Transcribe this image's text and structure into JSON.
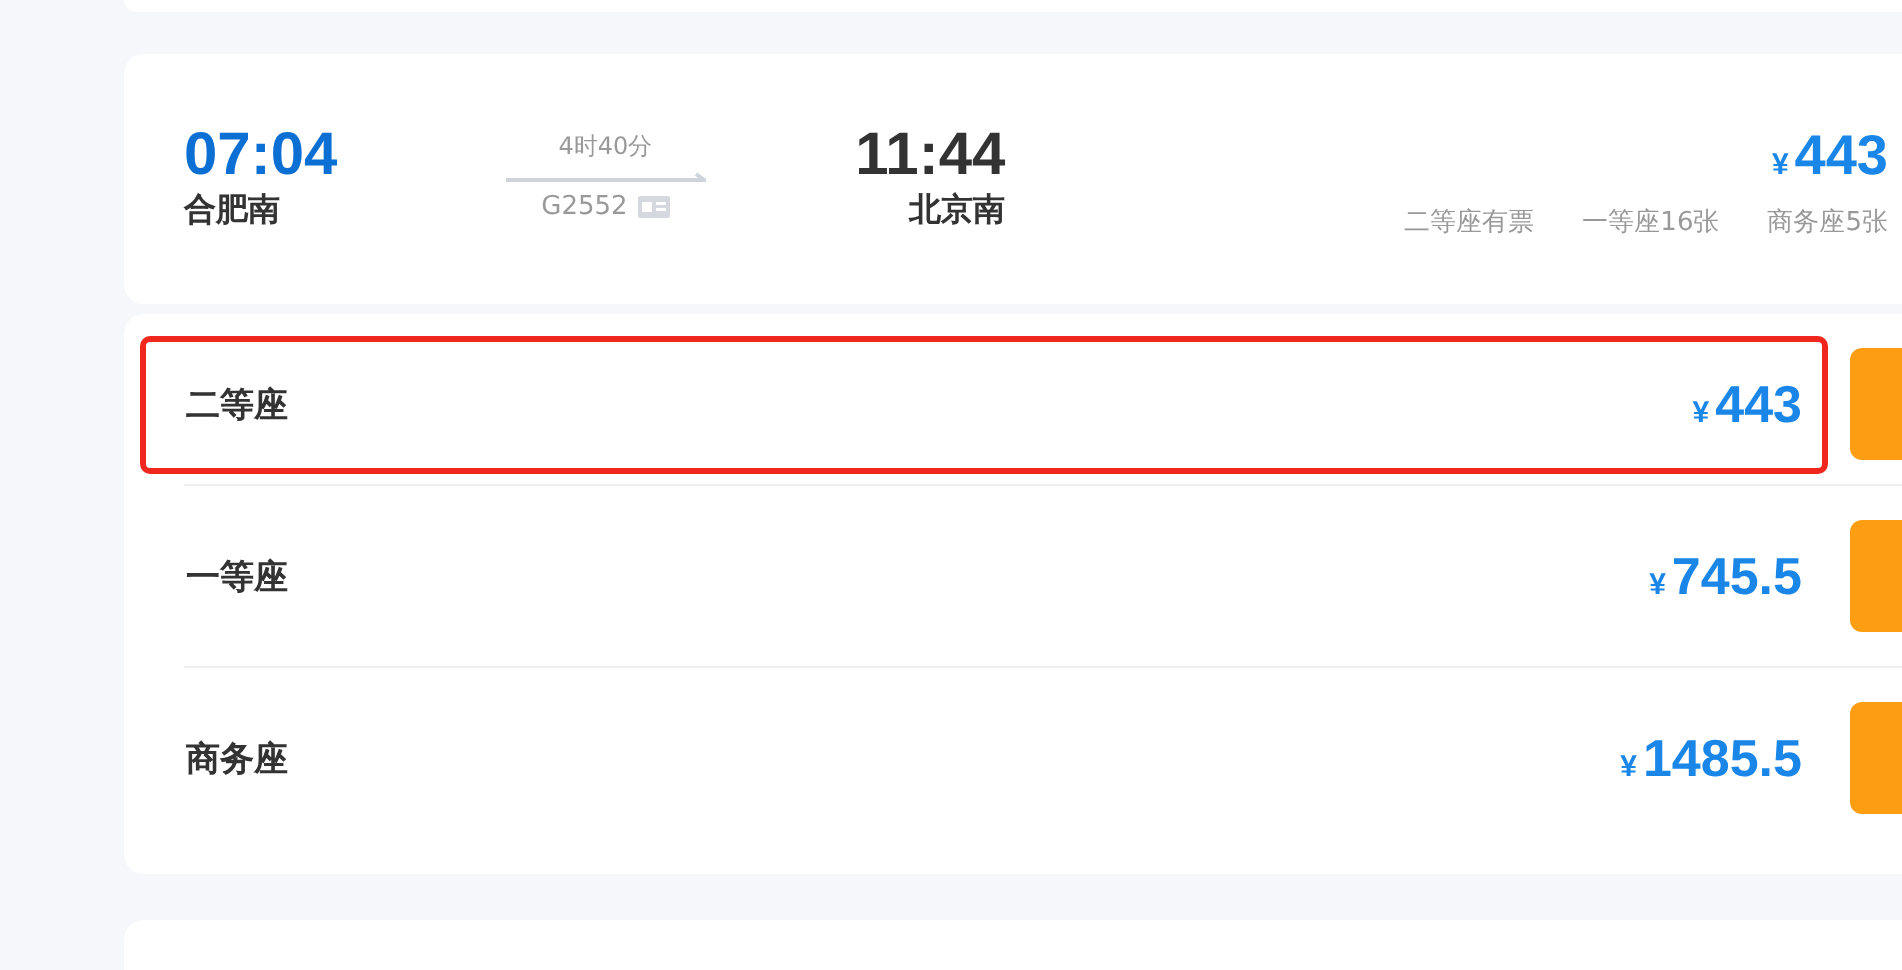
{
  "train": {
    "depart_time": "07:04",
    "depart_station": "合肥南",
    "duration": "4时40分",
    "train_no": "G2552",
    "arrive_time": "11:44",
    "arrive_station": "北京南",
    "min_price": "¥443",
    "availability": [
      "二等座有票",
      "一等座16张",
      "商务座5张"
    ]
  },
  "seats": [
    {
      "name": "二等座",
      "price": "¥443",
      "highlighted": true
    },
    {
      "name": "一等座",
      "price": "¥745.5",
      "highlighted": false
    },
    {
      "name": "商务座",
      "price": "¥1485.5",
      "highlighted": false
    }
  ]
}
